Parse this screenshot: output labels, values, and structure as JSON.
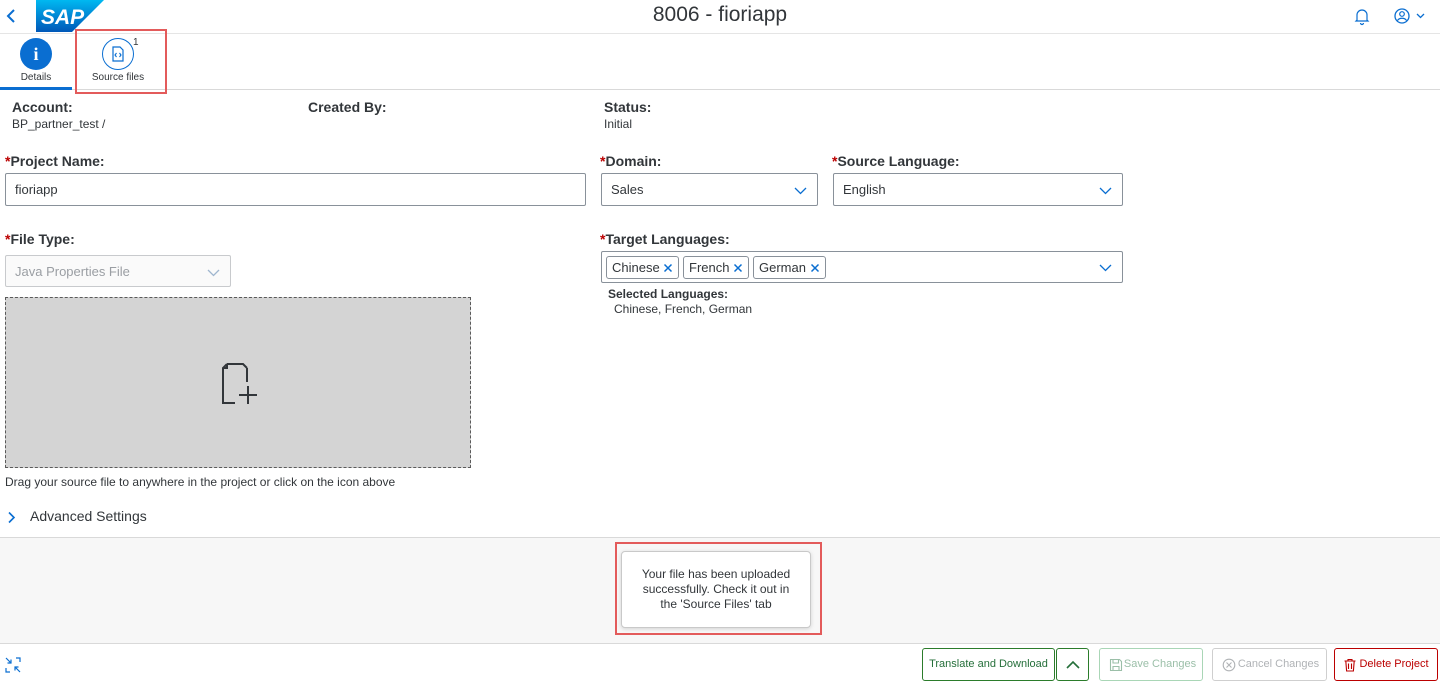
{
  "shell": {
    "title": "8006 - fioriapp",
    "logo_text": "SAP",
    "brand_color": "#0a6ed1",
    "icons": [
      "back-icon",
      "bell-icon",
      "user-icon",
      "chevron-down-icon"
    ]
  },
  "tabs": [
    {
      "label": "Details",
      "icon": "info-icon",
      "selected": true
    },
    {
      "label": "Source files",
      "icon": "source-code-icon",
      "count": "1"
    }
  ],
  "header_info": {
    "account_label": "Account:",
    "account_value": "BP_partner_test /",
    "created_by_label": "Created By:",
    "created_by_value": "",
    "status_label": "Status:",
    "status_value": "Initial"
  },
  "form": {
    "required_mark": "*",
    "project_name_label": "Project Name:",
    "project_name_value": "fioriapp",
    "domain_label": "Domain:",
    "domain_value": "Sales",
    "source_language_label": "Source Language:",
    "source_language_value": "English",
    "file_type_label": "File Type:",
    "file_type_value": "Java Properties File",
    "target_languages_label": "Target Languages:",
    "target_tokens": [
      "Chinese",
      "French",
      "German"
    ],
    "selected_languages_label": "Selected Languages:",
    "selected_languages_value": "Chinese, French, German"
  },
  "upload": {
    "icon": "add-document-icon",
    "hint": "Drag your source file to anywhere in the project or click on the icon above"
  },
  "advanced": {
    "label": "Advanced Settings"
  },
  "toast": {
    "lines": [
      "Your file has been uploaded",
      "successfully. Check it out in",
      "the 'Source Files' tab"
    ]
  },
  "footer": {
    "translate_label": "Translate and Download",
    "save_label": "Save Changes",
    "cancel_label": "Cancel Changes",
    "delete_label": "Delete Project",
    "delete_color": "#bb0000",
    "accept_color": "#256f3a"
  }
}
